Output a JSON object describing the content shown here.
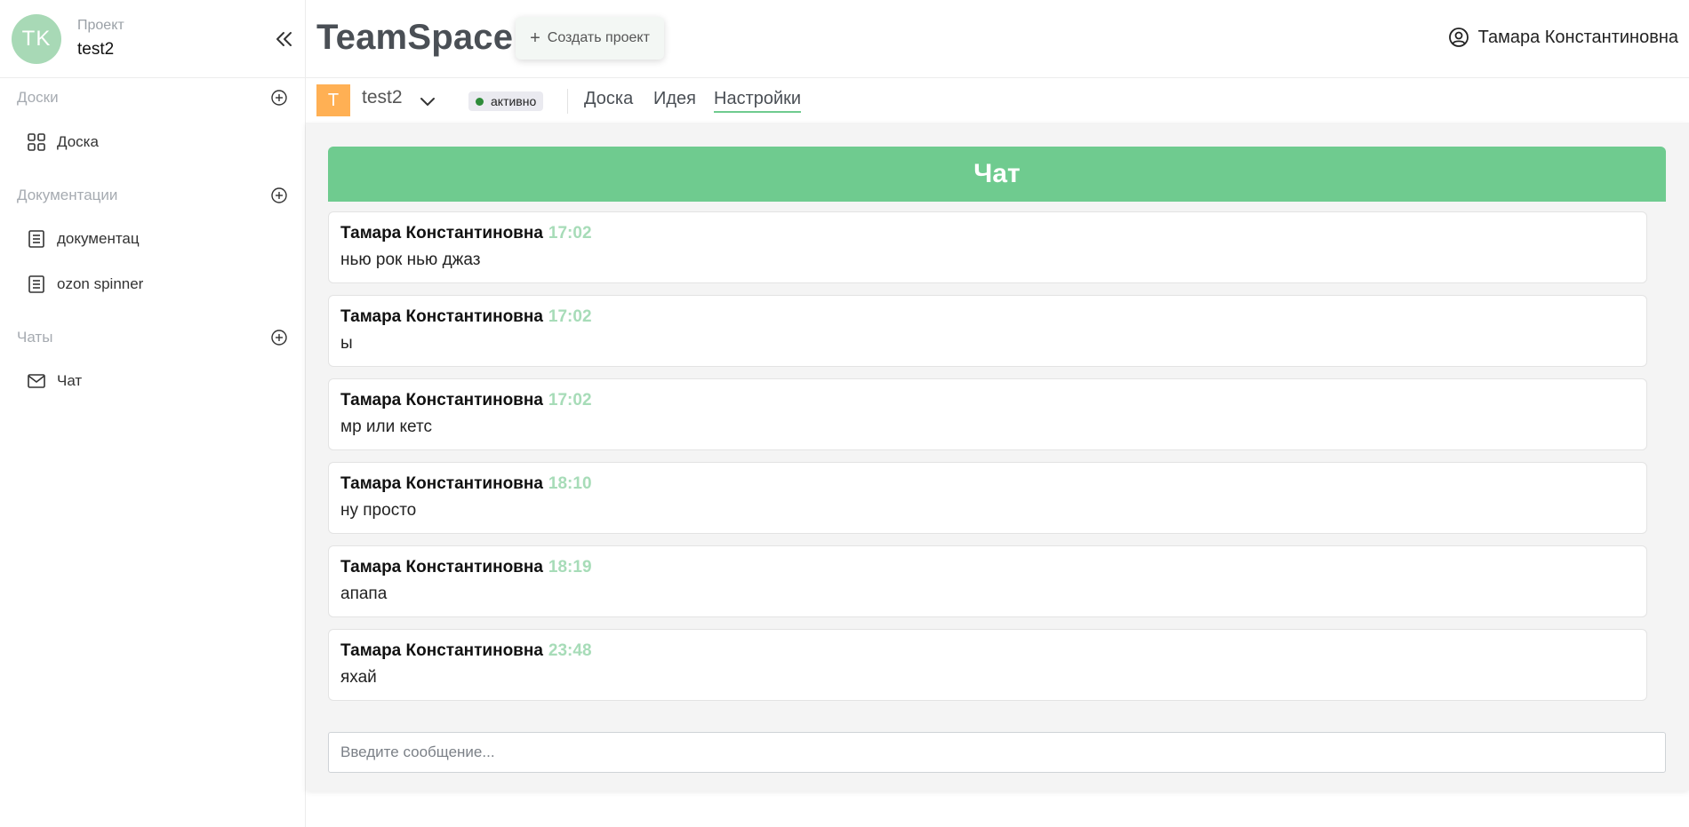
{
  "colors": {
    "accent": "#6fcb8f",
    "avatar": "#a8d9b6",
    "project_chip": "#ffb054",
    "status_dot": "#2e8b3a",
    "timestamp": "#a7dcb8"
  },
  "sidebar": {
    "avatar_initials": "TK",
    "project_caption": "Проект",
    "project_name": "test2",
    "collapse_icon": "double-chevron-left-icon",
    "sections": [
      {
        "title": "Доски",
        "items": [
          {
            "label": "Доска",
            "icon": "grid-icon"
          }
        ]
      },
      {
        "title": "Документации",
        "items": [
          {
            "label": "документац",
            "icon": "document-icon"
          },
          {
            "label": "ozon spinner",
            "icon": "document-icon"
          }
        ]
      },
      {
        "title": "Чаты",
        "items": [
          {
            "label": "Чат",
            "icon": "mail-icon"
          }
        ]
      }
    ]
  },
  "header": {
    "brand": "TeamSpace",
    "create_project": "Создать проект",
    "user_name": "Тамара Константиновна"
  },
  "subheader": {
    "project_chip": "T",
    "project_name": "test2",
    "status": "активно",
    "tabs": [
      {
        "label": "Доска",
        "active": false
      },
      {
        "label": "Идея",
        "active": false
      },
      {
        "label": "Настройки",
        "active": true
      }
    ]
  },
  "chat": {
    "title": "Чат",
    "messages": [
      {
        "author": "Тамара Константиновна",
        "time": "17:02",
        "text": "нью рок нью джаз"
      },
      {
        "author": "Тамара Константиновна",
        "time": "17:02",
        "text": "ы"
      },
      {
        "author": "Тамара Константиновна",
        "time": "17:02",
        "text": "мр или кетс"
      },
      {
        "author": "Тамара Константиновна",
        "time": "18:10",
        "text": "ну просто"
      },
      {
        "author": "Тамара Константиновна",
        "time": "18:19",
        "text": "апапа"
      },
      {
        "author": "Тамара Константиновна",
        "time": "23:48",
        "text": "яхай"
      }
    ],
    "input_placeholder": "Введите сообщение..."
  }
}
